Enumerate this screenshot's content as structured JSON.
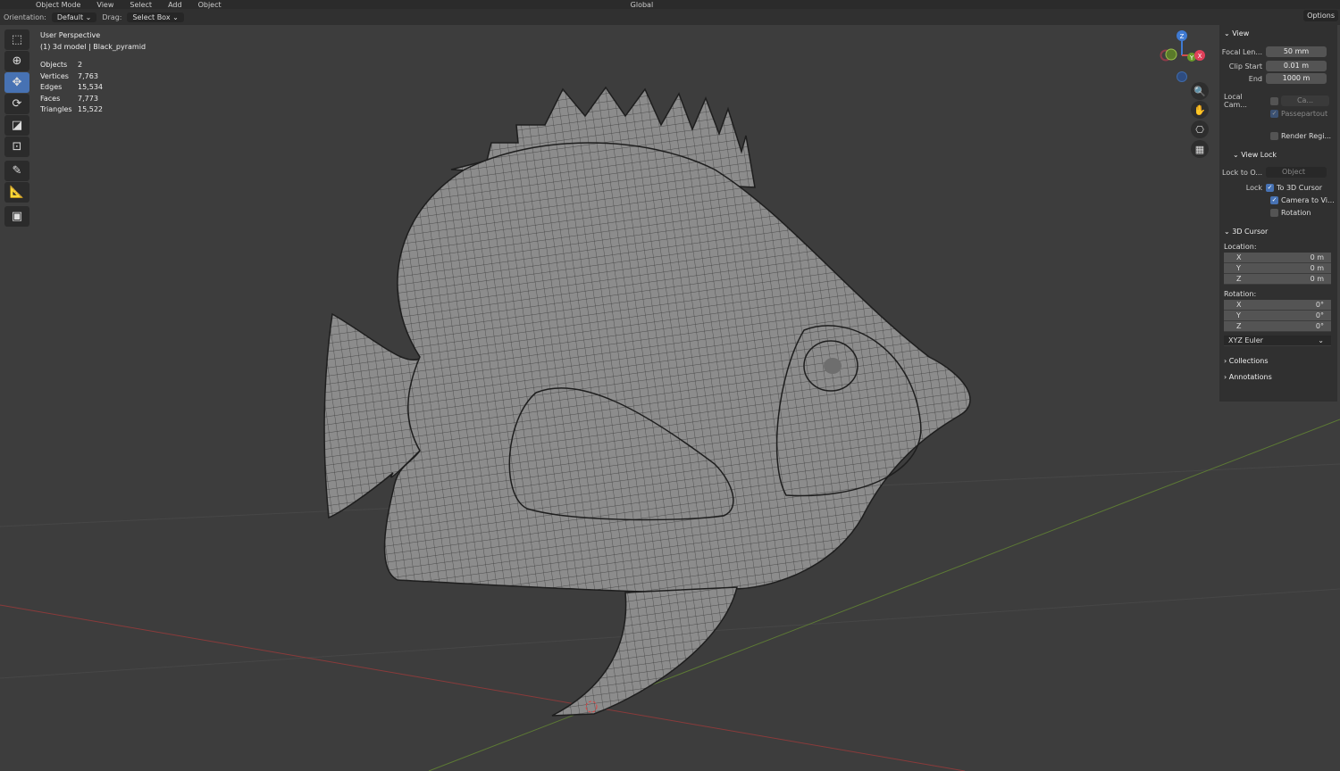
{
  "header": {
    "menus": [
      "Object Mode",
      "View",
      "Select",
      "Add",
      "Object"
    ],
    "transform": "Global"
  },
  "toolbar": {
    "orientation_label": "Orientation:",
    "orientation_value": "Default",
    "drag_label": "Drag:",
    "drag_value": "Select Box",
    "options": "Options"
  },
  "overlay": {
    "perspective": "User Perspective",
    "object": "(1) 3d model | Black_pyramid",
    "stats": [
      {
        "k": "Objects",
        "v": "2"
      },
      {
        "k": "Vertices",
        "v": "7,763"
      },
      {
        "k": "Edges",
        "v": "15,534"
      },
      {
        "k": "Faces",
        "v": "7,773"
      },
      {
        "k": "Triangles",
        "v": "15,522"
      }
    ]
  },
  "gizmo": {
    "z": "Z",
    "y": "Y",
    "x": "X"
  },
  "panel": {
    "view": {
      "title": "View",
      "focal_label": "Focal Len...",
      "focal": "50 mm",
      "clip_start_label": "Clip Start",
      "clip_start": "0.01 m",
      "end_label": "End",
      "end": "1000 m",
      "local_cam_label": "Local Cam...",
      "local_cam": "Ca...",
      "passepartout": "Passepartout",
      "render_region": "Render Regi..."
    },
    "view_lock": {
      "title": "View Lock",
      "lock_to_label": "Lock to O...",
      "lock_to": "Object",
      "lock_label": "Lock",
      "to_cursor": "To 3D Cursor",
      "camera_to_view": "Camera to Vi...",
      "rotation": "Rotation"
    },
    "cursor": {
      "title": "3D Cursor",
      "location_label": "Location:",
      "location": [
        {
          "a": "X",
          "v": "0 m"
        },
        {
          "a": "Y",
          "v": "0 m"
        },
        {
          "a": "Z",
          "v": "0 m"
        }
      ],
      "rotation_label": "Rotation:",
      "rotation": [
        {
          "a": "X",
          "v": "0°"
        },
        {
          "a": "Y",
          "v": "0°"
        },
        {
          "a": "Z",
          "v": "0°"
        }
      ],
      "mode": "XYZ Euler"
    },
    "collections": "Collections",
    "annotations": "Annotations"
  }
}
